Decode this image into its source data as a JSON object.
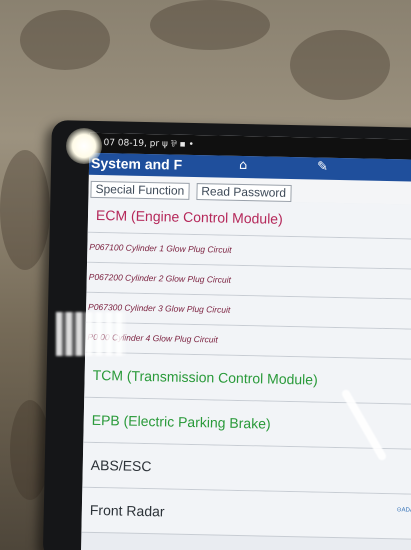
{
  "statusbar": {
    "text": "07  08-19, pr  ψ ⅌ ▪ •"
  },
  "app": {
    "title": "System and F"
  },
  "toolbar": {
    "icons": [
      "home-icon",
      "edit-icon"
    ]
  },
  "tabs": [
    {
      "label": "Special Function"
    },
    {
      "label": "Read Password"
    }
  ],
  "modules": {
    "ecm": "ECM (Engine Control Module)",
    "tcm": "TCM (Transmission Control Module)",
    "epb": "EPB (Electric Parking Brake)",
    "abs": "ABS/ESC",
    "radar": "Front Radar"
  },
  "dtcs": [
    {
      "text": "P067100 Cylinder 1 Glow Plug Circuit"
    },
    {
      "text": "P067200 Cylinder 2 Glow Plug Circuit"
    },
    {
      "text": "P067300 Cylinder 3 Glow Plug Circuit"
    },
    {
      "text": "P0    00 Cylinder 4 Glow Plug Circuit"
    }
  ],
  "badge": {
    "adas": "⊙ADAS"
  },
  "colors": {
    "titlebar": "#1f4f9c",
    "ecm_text": "#b5285a",
    "module_green": "#2a9a3a",
    "dtc_text": "#7c2240"
  }
}
